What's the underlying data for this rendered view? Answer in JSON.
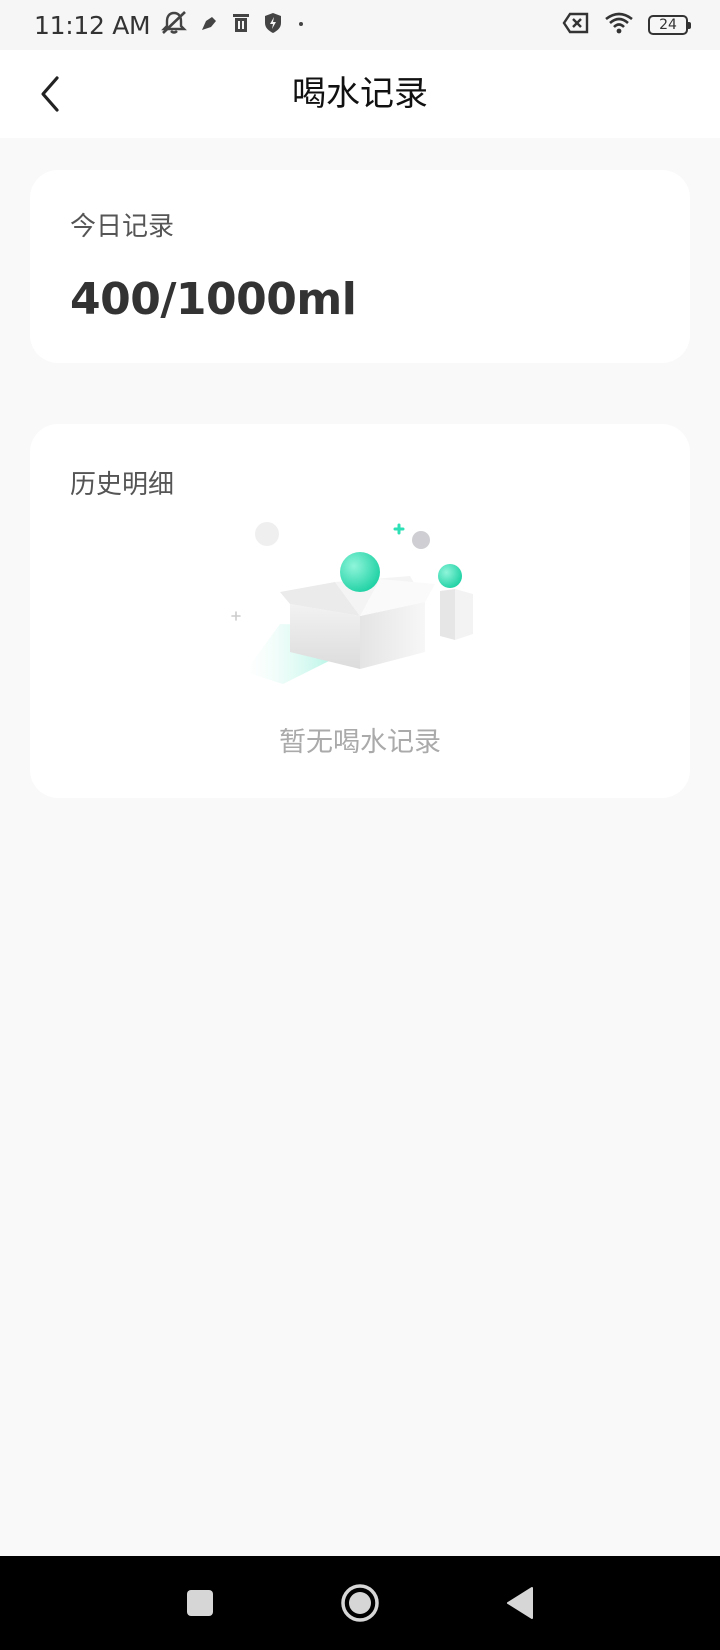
{
  "status_bar": {
    "time": "11:12 AM",
    "battery_level": "24",
    "icons": [
      "mute-bell-icon",
      "pen-icon",
      "trash-icon",
      "shield-icon",
      "dot-icon",
      "sim-off-icon",
      "wifi-icon",
      "battery-icon"
    ]
  },
  "header": {
    "title": "喝水记录",
    "back_icon": "chevron-left-icon"
  },
  "today_card": {
    "label": "今日记录",
    "value": "400/1000ml"
  },
  "history_card": {
    "label": "历史明细",
    "empty_text": "暂无喝水记录",
    "illustration": "empty-box-illustration"
  },
  "nav_bar": {
    "icons": [
      "recents-square-icon",
      "home-circle-icon",
      "back-triangle-icon"
    ]
  },
  "colors": {
    "accent": "#2ee0b5",
    "background": "#f9f9f9",
    "card": "#ffffff",
    "muted_text": "#aaaaaa"
  }
}
